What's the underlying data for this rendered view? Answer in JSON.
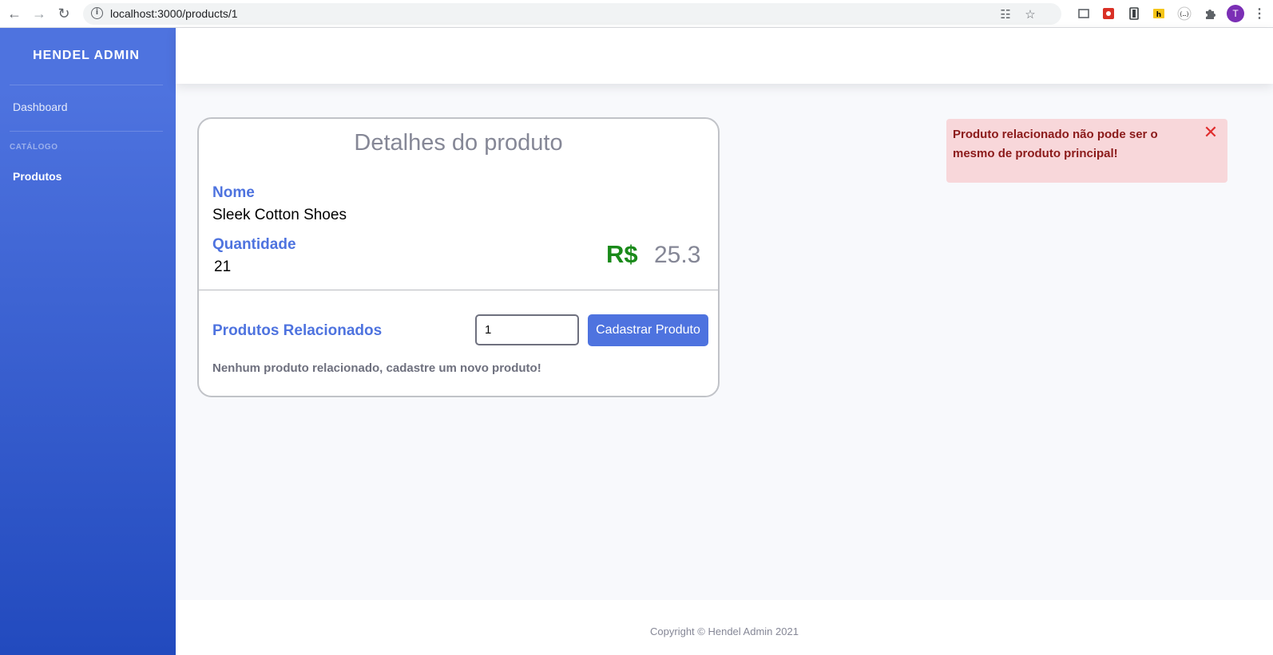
{
  "browser": {
    "url": "localhost:3000/products/1",
    "profile_initial": "T"
  },
  "sidebar": {
    "brand": "HENDEL ADMIN",
    "items": [
      {
        "label": "Dashboard"
      },
      {
        "heading": "CATÁLOGO"
      },
      {
        "label": "Produtos",
        "active": true
      }
    ]
  },
  "product": {
    "title": "Detalhes do produto",
    "name_label": "Nome",
    "name_value": "Sleek Cotton Shoes",
    "quantity_label": "Quantidade",
    "quantity_value": "21",
    "price_symbol": "R$",
    "price_value": "25.3",
    "related_label": "Produtos Relacionados",
    "related_input_value": "1",
    "add_button": "Cadastrar Produto",
    "empty_message": "Nenhum produto relacionado, cadastre um novo produto!"
  },
  "alert": {
    "message": "Produto relacionado não pode ser o mesmo de produto principal!",
    "close_symbol": "✕"
  },
  "footer": {
    "copyright": "Copyright © Hendel Admin 2021"
  },
  "colors": {
    "primary": "#4e73df",
    "price_green": "#1a8a1a",
    "alert_bg": "#f8d7da",
    "alert_text": "#8b1a1a"
  }
}
